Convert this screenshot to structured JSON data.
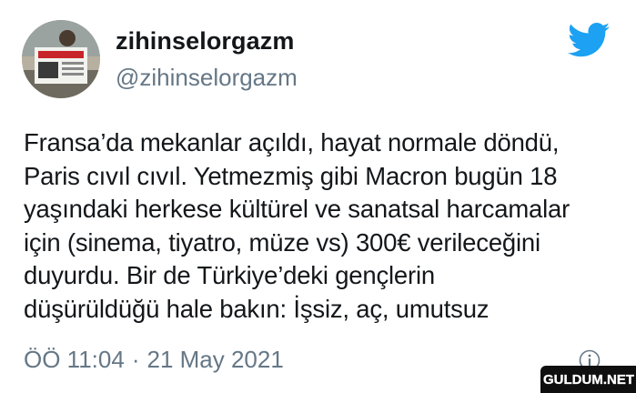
{
  "tweet": {
    "author": {
      "display_name": "zihinselorgazm",
      "handle": "@zihinselorgazm"
    },
    "text_lines": [
      "Fransa’da mekanlar açıldı, hayat normale döndü,",
      "Paris cıvıl cıvıl. Yetmezmiş gibi Macron bugün 18",
      "yaşındaki herkese kültürel ve sanatsal harcamalar",
      "için (sinema, tiyatro, müze vs) 300€ verileceğini",
      "duyurdu. Bir de Türkiye’deki gençlerin",
      "düşürüldüğü hale bakın: İşsiz, aç, umutsuz"
    ],
    "time": "ÖÖ 11:04",
    "separator": "·",
    "date": "21 May 2021"
  },
  "watermark": {
    "text": "GULDUM.NET"
  },
  "icons": {
    "brand": "twitter-bird-icon",
    "info": "info-icon"
  },
  "colors": {
    "twitter_blue": "#1da1f2",
    "secondary_text": "#657786",
    "primary_text": "#14171a"
  }
}
